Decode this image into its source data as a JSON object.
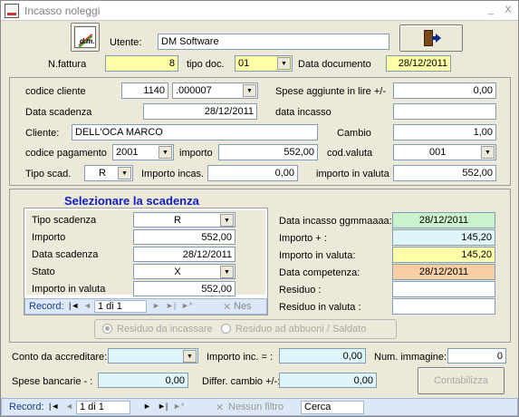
{
  "window": {
    "title": "Incasso noleggi",
    "minimize": "_",
    "close": "X"
  },
  "header": {
    "utente_label": "Utente:",
    "utente_value": "DM Software",
    "nfattura_label": "N.fattura",
    "nfattura_value": "8",
    "tipodoc_label": "tipo doc.",
    "tipodoc_value": "01",
    "datadoc_label": "Data documento",
    "datadoc_value": "28/12/2011"
  },
  "main": {
    "codice_cliente_label": "codice cliente",
    "codice_cliente_value": "1140",
    "codice_cliente_suffix": ".000007",
    "spese_label": "Spese aggiunte in lire +/-",
    "spese_value": "0,00",
    "data_scadenza_label": "Data scadenza",
    "data_scadenza_value": "28/12/2011",
    "data_incasso_label": "data incasso",
    "data_incasso_value": "",
    "cliente_label": "Cliente:",
    "cliente_value": "DELL'OCA MARCO",
    "cambio_label": "Cambio",
    "cambio_value": "1,00",
    "codice_pagamento_label": "codice pagamento",
    "codice_pagamento_value": "2001",
    "importo_label": "importo",
    "importo_value": "552,00",
    "cod_valuta_label": "cod.valuta",
    "cod_valuta_value": "001",
    "tipo_scad_label": "Tipo scad.",
    "tipo_scad_value": "R",
    "importo_incas_label": "Importo incas.",
    "importo_incas_value": "0,00",
    "importo_valuta_label": "importo in valuta",
    "importo_valuta_value": "552,00"
  },
  "scadenza": {
    "heading": "Selezionare la scadenza",
    "tipo_label": "Tipo scadenza",
    "tipo_value": "R",
    "importo_label": "Importo",
    "importo_value": "552,00",
    "data_label": "Data scadenza",
    "data_value": "28/12/2011",
    "stato_label": "Stato",
    "stato_value": "X",
    "importo_valuta_label": "Importo in valuta",
    "importo_valuta_value": "552,00",
    "nav": {
      "record_label": "Record:",
      "first": "|◄",
      "prev": "◄",
      "position": "1 di 1",
      "next": "►",
      "last": "►|",
      "new": "►*",
      "filter_icon": "✕",
      "filter": "Nes"
    },
    "data_incasso_label": "Data incasso ggmmaaaa:",
    "data_incasso_value": "28/12/2011",
    "importo_plus_label": "Importo + :",
    "importo_plus_value": "145,20",
    "importo_valuta2_label": "Importo in valuta:",
    "importo_valuta2_value": "145,20",
    "data_competenza_label": "Data competenza:",
    "data_competenza_value": "28/12/2011",
    "residuo_label": "Residuo :",
    "residuo_value": "",
    "residuo_valuta_label": "Residuo in valuta :",
    "residuo_valuta_value": "",
    "radio_residuo": "Residuo da incassare",
    "radio_abbuoni": "Residuo ad abbuoni / Saldato"
  },
  "footer": {
    "conto_label": "Conto da accreditare:",
    "conto_value": "",
    "importo_inc_label": "Importo inc. = :",
    "importo_inc_value": "0,00",
    "num_immagine_label": "Num. immagine:",
    "num_immagine_value": "0",
    "spese_bancarie_label": "Spese bancarie - :",
    "spese_bancarie_value": "0,00",
    "differ_cambio_label": "Differ. cambio +/-:",
    "differ_cambio_value": "0,00",
    "contabilizza": "Contabilizza"
  },
  "statusbar": {
    "record_label": "Record:",
    "first": "|◄",
    "prev": "◄",
    "position": "1 di 1",
    "next": "►",
    "last": "►|",
    "new": "►*",
    "filter_icon": "✕",
    "filter": "Nessun filtro",
    "search": "Cerca"
  },
  "logo_text": "d.m.",
  "exit_icon": "exit-door-icon",
  "colors": {
    "yellow": "#FFFFA8",
    "cyan": "#DFF5FA",
    "green": "#CCF2CC",
    "orange": "#F8CFA4",
    "heading": "#1020C0"
  }
}
